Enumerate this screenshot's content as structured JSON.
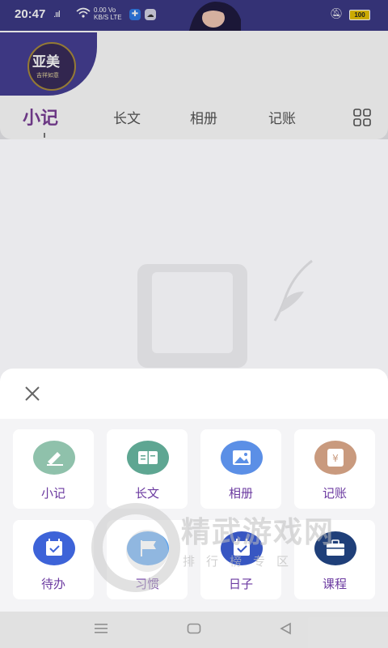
{
  "status_bar": {
    "time": "20:47",
    "signal": ".ııl",
    "network_speed_top": "0.00",
    "network_speed_bottom": "KB/S",
    "network_type_top": "Vo",
    "network_type_bottom": "LTE",
    "battery": "100"
  },
  "logo": {
    "title": "亚美",
    "subtitle": "吉祥如意"
  },
  "tabs": [
    {
      "label": "小记"
    },
    {
      "label": "长文"
    },
    {
      "label": "相册"
    },
    {
      "label": "记账"
    }
  ],
  "sheet": {
    "items": [
      {
        "label": "小记",
        "color": "#8fc1ab",
        "icon": "pen-icon"
      },
      {
        "label": "长文",
        "color": "#5ea692",
        "icon": "book-icon"
      },
      {
        "label": "相册",
        "color": "#5b8fe6",
        "icon": "image-icon"
      },
      {
        "label": "记账",
        "color": "#c99a7e",
        "icon": "yen-notebook-icon"
      },
      {
        "label": "待办",
        "color": "#3d63d8",
        "icon": "calendar-check-icon"
      },
      {
        "label": "习惯",
        "color": "#5aa1ec",
        "icon": "flag-icon"
      },
      {
        "label": "日子",
        "color": "#3756c2",
        "icon": "calendar-check-icon"
      },
      {
        "label": "课程",
        "color": "#1f3f79",
        "icon": "briefcase-icon"
      }
    ]
  },
  "watermark": {
    "title": "精武游戏网",
    "subtitle": "排行榜专区"
  }
}
